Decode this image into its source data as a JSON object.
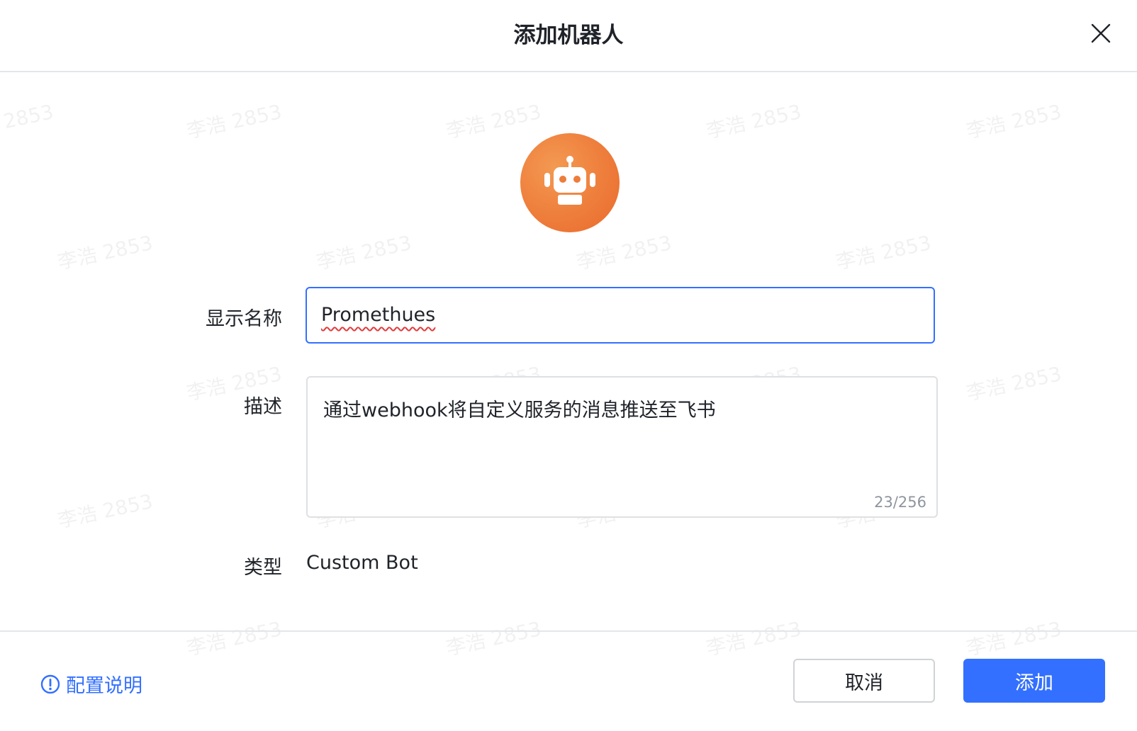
{
  "dialog": {
    "title": "添加机器人",
    "close_icon": "close-icon"
  },
  "avatar": {
    "icon": "robot-icon",
    "color": "#ee7d3b"
  },
  "form": {
    "name_label": "显示名称",
    "name_value": "Promethues",
    "desc_label": "描述",
    "desc_value": "通过webhook将自定义服务的消息推送至飞书",
    "desc_counter": "23/256",
    "type_label": "类型",
    "type_value": "Custom Bot"
  },
  "footer": {
    "help_label": "配置说明",
    "cancel_label": "取消",
    "add_label": "添加"
  },
  "colors": {
    "primary": "#3370ff",
    "border": "#dee0e3",
    "text": "#1f2329",
    "muted": "#8f959e"
  },
  "watermark": "李浩 2853"
}
